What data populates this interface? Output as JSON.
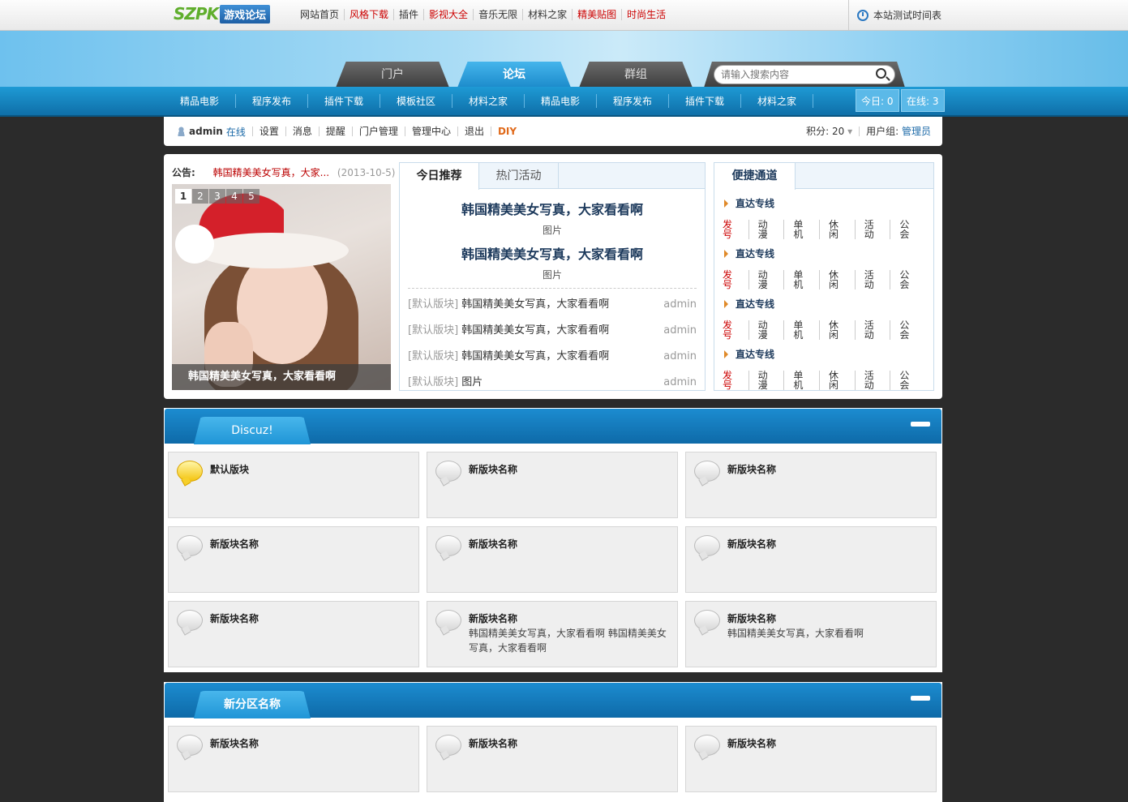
{
  "topbar": {
    "logo_text": "SZPK",
    "logo_sub": "游戏论坛",
    "links": [
      {
        "label": "网站首页",
        "red": false
      },
      {
        "label": "风格下载",
        "red": true
      },
      {
        "label": "插件",
        "red": false
      },
      {
        "label": "影视大全",
        "red": true
      },
      {
        "label": "音乐无限",
        "red": false
      },
      {
        "label": "材料之家",
        "red": false
      },
      {
        "label": "精美贴图",
        "red": true
      },
      {
        "label": "时尚生活",
        "red": true
      }
    ],
    "right_text": "本站测试时间表"
  },
  "main_tabs": [
    {
      "label": "门户",
      "active": false
    },
    {
      "label": "论坛",
      "active": true
    },
    {
      "label": "群组",
      "active": false
    }
  ],
  "search": {
    "placeholder": "请输入搜索内容"
  },
  "nav": {
    "items": [
      "精品电影",
      "程序发布",
      "插件下载",
      "模板社区",
      "材料之家",
      "精品电影",
      "程序发布",
      "插件下载",
      "材料之家"
    ],
    "today": "今日: 0",
    "online": "在线: 3"
  },
  "userbar": {
    "username": "admin",
    "status": "在线",
    "links": [
      "设置",
      "消息",
      "提醒",
      "门户管理",
      "管理中心",
      "退出"
    ],
    "diy": "DIY",
    "points": "积分: 20",
    "group_label": "用户组:",
    "group_value": "管理员"
  },
  "notice": {
    "label": "公告:",
    "text": "韩国精美美女写真，大家...",
    "date": "(2013-10-5)"
  },
  "slider": {
    "numbers": [
      "1",
      "2",
      "3",
      "4",
      "5"
    ],
    "caption": "韩国精美美女写真，大家看看啊"
  },
  "recommend": {
    "tabs": [
      "今日推荐",
      "热门活动"
    ],
    "headlines": [
      {
        "title": "韩国精美美女写真，大家看看啊",
        "sub": "图片"
      },
      {
        "title": "韩国精美美女写真，大家看看啊",
        "sub": "图片"
      }
    ],
    "list": [
      {
        "cat": "[默认版块]",
        "title": "韩国精美美女写真，大家看看啊",
        "author": "admin"
      },
      {
        "cat": "[默认版块]",
        "title": "韩国精美美女写真，大家看看啊",
        "author": "admin"
      },
      {
        "cat": "[默认版块]",
        "title": "韩国精美美女写真，大家看看啊",
        "author": "admin"
      },
      {
        "cat": "[默认版块]",
        "title": "图片",
        "author": "admin"
      }
    ]
  },
  "quick": {
    "tab": "便捷通道",
    "groups": [
      {
        "title": "直达专线",
        "links": [
          "发号",
          "动漫",
          "单机",
          "休闲",
          "活动",
          "公会"
        ]
      },
      {
        "title": "直达专线",
        "links": [
          "发号",
          "动漫",
          "单机",
          "休闲",
          "活动",
          "公会"
        ]
      },
      {
        "title": "直达专线",
        "links": [
          "发号",
          "动漫",
          "单机",
          "休闲",
          "活动",
          "公会"
        ]
      },
      {
        "title": "直达专线",
        "links": [
          "发号",
          "动漫",
          "单机",
          "休闲",
          "活动",
          "公会"
        ]
      }
    ]
  },
  "sections": [
    {
      "title": "Discuz!",
      "forums": [
        {
          "name": "默认版块",
          "desc": "",
          "icon": "yellow-bubble-icon"
        },
        {
          "name": "新版块名称",
          "desc": "",
          "icon": "gray-bubble-icon"
        },
        {
          "name": "新版块名称",
          "desc": "",
          "icon": "gray-bubble-icon"
        },
        {
          "name": "新版块名称",
          "desc": "",
          "icon": "gray-bubble-icon"
        },
        {
          "name": "新版块名称",
          "desc": "",
          "icon": "gray-bubble-icon"
        },
        {
          "name": "新版块名称",
          "desc": "",
          "icon": "gray-bubble-icon"
        },
        {
          "name": "新版块名称",
          "desc": "",
          "icon": "gray-bubble-icon"
        },
        {
          "name": "新版块名称",
          "desc": "韩国精美美女写真，大家看看啊  韩国精美美女写真，大家看看啊",
          "icon": "gray-bubble-icon"
        },
        {
          "name": "新版块名称",
          "desc": "韩国精美美女写真，大家看看啊",
          "icon": "gray-bubble-icon"
        }
      ]
    },
    {
      "title": "新分区名称",
      "forums": [
        {
          "name": "新版块名称",
          "desc": "",
          "icon": "gray-bubble-icon"
        },
        {
          "name": "新版块名称",
          "desc": "",
          "icon": "gray-bubble-icon"
        },
        {
          "name": "新版块名称",
          "desc": "",
          "icon": "gray-bubble-icon"
        }
      ]
    }
  ]
}
